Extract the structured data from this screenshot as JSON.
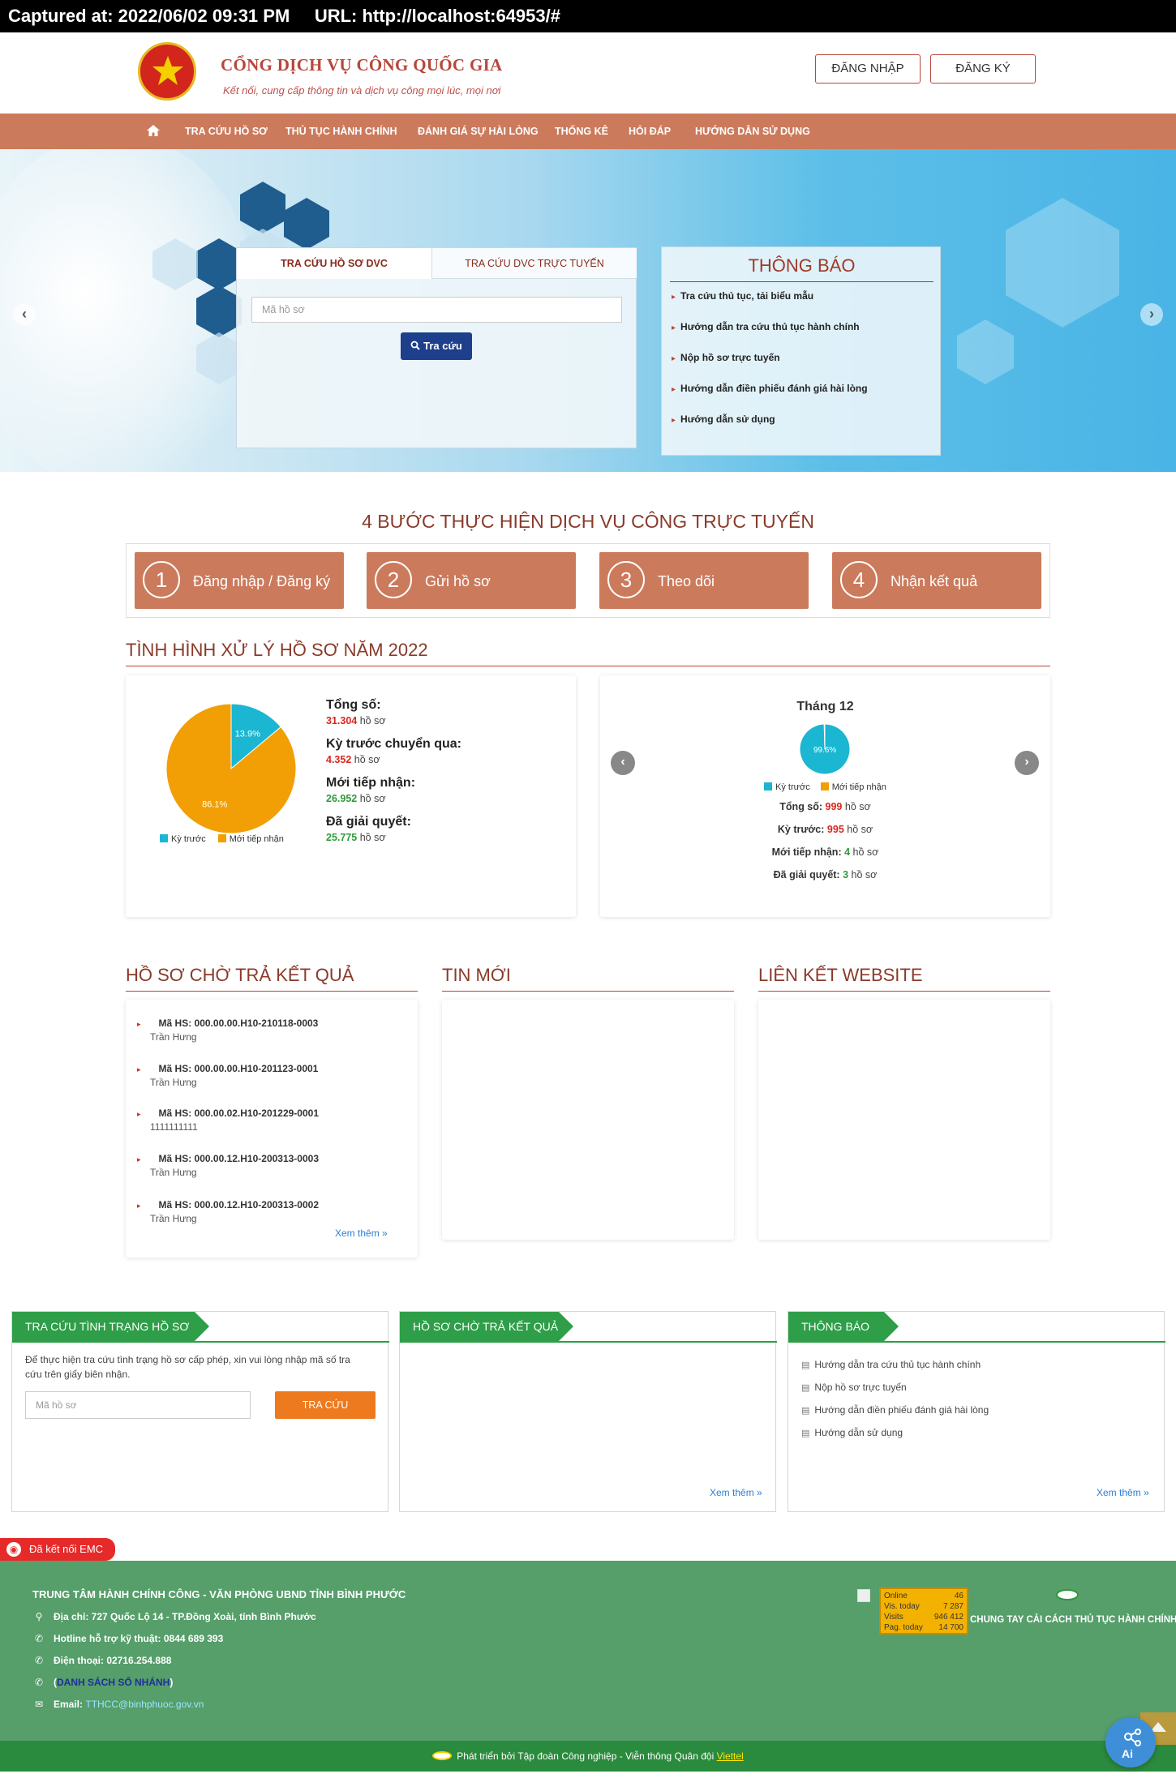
{
  "capture": {
    "text": "Captured at: 2022/06/02 09:31 PM     URL: http://localhost:64953/#"
  },
  "header": {
    "title": "CỔNG DỊCH VỤ CÔNG QUỐC GIA",
    "subtitle": "Kết nối, cung cấp thông tin và dịch vụ công mọi lúc, mọi nơi",
    "login": "ĐĂNG NHẬP",
    "register": "ĐĂNG KÝ"
  },
  "nav": {
    "items": [
      "TRA CỨU HỒ SƠ",
      "THỦ TỤC HÀNH CHÍNH",
      "ĐÁNH GIÁ SỰ HÀI LÒNG",
      "THỐNG KÊ",
      "HỎI ĐÁP",
      "HƯỚNG DẪN SỬ DỤNG"
    ]
  },
  "search": {
    "tab1": "TRA CỨU HỒ SƠ DVC",
    "tab2": "TRA CỨU DVC TRỰC TUYẾN",
    "placeholder": "Mã hồ sơ",
    "button": "Tra cứu"
  },
  "notice": {
    "title": "THÔNG BÁO",
    "items": [
      "Tra cứu thủ tục, tải biểu mẫu",
      "Hướng dẫn tra cứu thủ tục hành chính",
      "Nộp hồ sơ trực tuyến",
      "Hướng dẫn điền phiếu đánh giá hài lòng",
      "Hướng dẫn sử dụng"
    ]
  },
  "steps": {
    "title": "4 BƯỚC THỰC HIỆN DỊCH VỤ CÔNG TRỰC TUYẾN",
    "items": [
      {
        "num": "1",
        "label": "Đăng nhập / Đăng ký"
      },
      {
        "num": "2",
        "label": "Gửi hồ sơ"
      },
      {
        "num": "3",
        "label": "Theo dõi"
      },
      {
        "num": "4",
        "label": "Nhận kết quả"
      }
    ]
  },
  "status": {
    "title": "TÌNH HÌNH XỬ LÝ HỒ SƠ NĂM 2022",
    "total_label": "Tổng số:",
    "total_value": "31.304",
    "unit": "hồ sơ",
    "prev_label": "Kỳ trước chuyển qua:",
    "prev_value": "4.352",
    "new_label": "Mới tiếp nhận:",
    "new_value": "26.952",
    "done_label": "Đã giải quyết:",
    "done_value": "25.775",
    "legend_prev": "Kỳ trước",
    "legend_new": "Mới tiếp nhận",
    "colors": {
      "prev": "#1ab6d2",
      "new": "#f29f05"
    }
  },
  "chart_data": [
    {
      "type": "pie",
      "categories": [
        "Kỳ trước",
        "Mới tiếp nhận"
      ],
      "values": [
        13.9,
        86.1
      ],
      "labels": [
        "13.9%",
        "86.1%"
      ]
    },
    {
      "type": "pie",
      "title": "Tháng 12",
      "categories": [
        "Kỳ trước",
        "Mới tiếp nhận"
      ],
      "values": [
        99.6,
        0.4
      ],
      "labels": [
        "99.6%"
      ]
    }
  ],
  "monthly": {
    "title": "Tháng 12",
    "total_label": "Tổng số:",
    "total_value": "999",
    "prev_label": "Kỳ trước:",
    "prev_value": "995",
    "new_label": "Mới tiếp nhận:",
    "new_value": "4",
    "done_label": "Đã giải quyết:",
    "done_value": "3",
    "unit": "hồ sơ",
    "prev_arrow": "‹",
    "next_arrow": "›"
  },
  "pending": {
    "title": "HỒ SƠ CHỜ TRẢ KẾT QUẢ",
    "items": [
      {
        "code": "Mã HS: 000.00.00.H10-210118-0003",
        "name": "Trần Hưng"
      },
      {
        "code": "Mã HS: 000.00.00.H10-201123-0001",
        "name": "Trần Hưng"
      },
      {
        "code": "Mã HS: 000.00.02.H10-201229-0001",
        "name": "1111111111"
      },
      {
        "code": "Mã HS: 000.00.12.H10-200313-0003",
        "name": "Trần Hưng"
      },
      {
        "code": "Mã HS: 000.00.12.H10-200313-0002",
        "name": "Trần Hưng"
      }
    ],
    "more": "Xem thêm »"
  },
  "news": {
    "title": "TIN MỚI"
  },
  "links": {
    "title": "LIÊN KẾT WEBSITE"
  },
  "green_cards": {
    "lookup": {
      "title": "TRA CỨU TÌNH TRẠNG HỒ SƠ",
      "desc": "Để thực hiện tra cứu tình trạng hồ sơ cấp phép, xin vui lòng nhập mã số tra cứu trên giấy biên nhận.",
      "placeholder": "Mã hồ sơ",
      "button": "TRA CỨU"
    },
    "pending": {
      "title": "HỒ SƠ CHỜ TRẢ KẾT QUẢ",
      "more": "Xem thêm »"
    },
    "notice": {
      "title": "THÔNG BÁO",
      "items": [
        "Hướng dẫn tra cứu thủ tục hành chính",
        "Nộp hồ sơ trực tuyến",
        "Hướng dẫn điền phiếu đánh giá hài lòng",
        "Hướng dẫn sử dụng"
      ],
      "more": "Xem thêm »"
    }
  },
  "emc": {
    "label": "Đã kết nối EMC"
  },
  "footer": {
    "org": "TRUNG TÂM HÀNH CHÍNH CÔNG - VĂN PHÒNG UBND TỈNH BÌNH PHƯỚC",
    "address": "Địa chỉ: 727 Quốc Lộ 14 - TP.Đồng Xoài, tỉnh Bình Phước",
    "hotline": "Hotline hỗ trợ kỹ thuật: 0844 689 393",
    "phone": "Điện thoại: 02716.254.888",
    "hotlines_link": "DANH SÁCH SỐ NHÁNH",
    "email_label": "Email:",
    "email": "TTHCC@binhphuoc.gov.vn",
    "counter": {
      "online_label": "Online",
      "online": "46",
      "today_label": "Vis. today",
      "today": "7 287",
      "visits_label": "Visits",
      "visits": "946 412",
      "pag_label": "Pag. today",
      "pag": "14 700"
    },
    "reform": "CHUNG TAY CẢI CÁCH THỦ TỤC HÀNH CHÍNH",
    "credit": "Phát triển bởi Tập đoàn Công nghiệp - Viễn thông Quân đội",
    "credit_link": "Viettel"
  }
}
